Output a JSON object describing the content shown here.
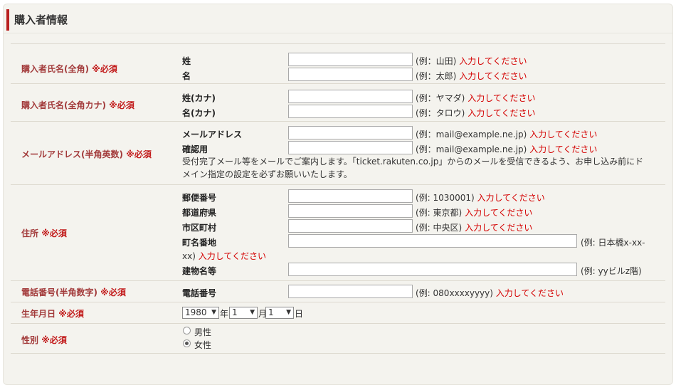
{
  "section_title": "購入者情報",
  "required_mark": "※必須",
  "rows": {
    "name_kanji": {
      "label": "購入者氏名(全角)",
      "fields": [
        {
          "label": "姓",
          "example": "(例：山田)",
          "error": "入力してください"
        },
        {
          "label": "名",
          "example": "(例：太郎)",
          "error": "入力してください"
        }
      ]
    },
    "name_kana": {
      "label": "購入者氏名(全角カナ)",
      "fields": [
        {
          "label": "姓(カナ)",
          "example": "(例：ヤマダ)",
          "error": "入力してください"
        },
        {
          "label": "名(カナ)",
          "example": "(例：タロウ)",
          "error": "入力してください"
        }
      ]
    },
    "email": {
      "label": "メールアドレス(半角英数)",
      "fields": [
        {
          "label": "メールアドレス",
          "example": "(例：mail@example.ne.jp)",
          "error": "入力してください"
        },
        {
          "label": "確認用",
          "example": "(例：mail@example.ne.jp)",
          "error": "入力してください"
        }
      ],
      "note_line1": "受付完了メール等をメールでご案内します。「ticket.rakuten.co.jp」からのメールを受信できるよう、お申し込み前にド",
      "note_line2": "メイン指定の設定を必ずお願いいたします。"
    },
    "address": {
      "label": "住所",
      "fields": [
        {
          "label": "郵便番号",
          "example": "(例: 1030001)",
          "error": "入力してください"
        },
        {
          "label": "都道府県",
          "example": "(例: 東京都)",
          "error": "入力してください"
        },
        {
          "label": "市区町村",
          "example": "(例: 中央区)",
          "error": "入力してください"
        },
        {
          "label": "町名番地",
          "example": "(例: 日本橋x-xx-",
          "example_cont": "xx)",
          "error": "入力してください"
        },
        {
          "label": "建物名等",
          "example": "(例: yyビルz階)"
        }
      ]
    },
    "phone": {
      "label": "電話番号(半角数字)",
      "fields": [
        {
          "label": "電話番号",
          "example": "(例: 080xxxxyyyy)",
          "error": "入力してください"
        }
      ]
    },
    "birthdate": {
      "label": "生年月日",
      "year": "1980",
      "year_unit": "年",
      "month": "1",
      "month_unit": "月",
      "day": "1",
      "day_unit": "日"
    },
    "gender": {
      "label": "性別",
      "options": [
        "男性",
        "女性"
      ],
      "selected": "女性"
    }
  }
}
